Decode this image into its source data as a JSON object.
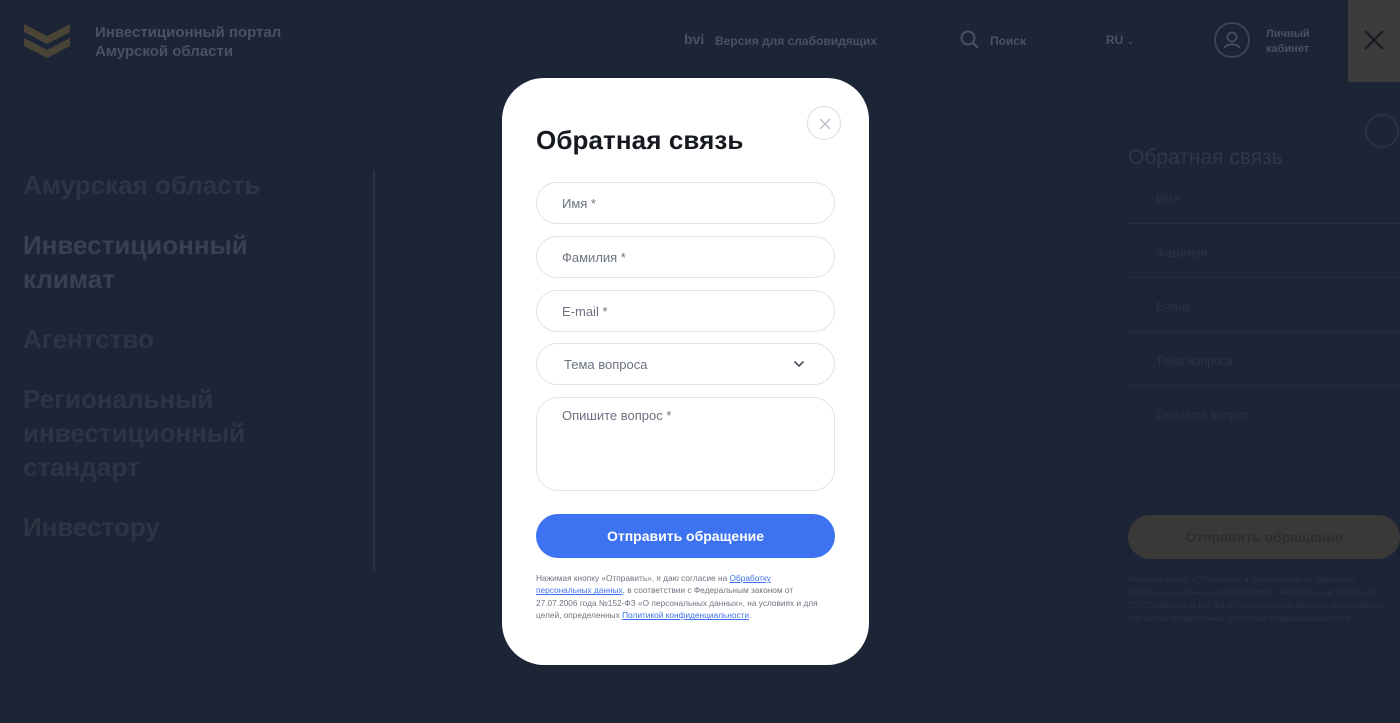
{
  "header": {
    "logo_line1": "Инвестиционный портал",
    "logo_line2": "Амурской области",
    "bvi_icon": "bvi",
    "accessibility_label": "Версия для слабовидящих",
    "search_label": "Поиск",
    "language": "RU",
    "cabinet_line1": "Личный",
    "cabinet_line2": "кабинет"
  },
  "menu": {
    "items": [
      {
        "label": "Амурская область"
      },
      {
        "label": "Инвестиционный климат"
      },
      {
        "label": "Агентство"
      },
      {
        "label": "Региональный инвестиционный стандарт"
      },
      {
        "label": "Инвестору"
      }
    ]
  },
  "background_form": {
    "title": "Обратная связь",
    "fields": [
      "Имя",
      "Фамилия",
      "E-mail",
      "Тема вопроса",
      "Опишите вопрос"
    ],
    "submit_label": "Отправить обращение"
  },
  "modal": {
    "title": "Обратная связь",
    "name_placeholder": "Имя *",
    "surname_placeholder": "Фамилия *",
    "email_placeholder": "E-mail *",
    "topic_label": "Тема вопроса",
    "question_placeholder": "Опишите вопрос *",
    "submit_label": "Отправить обращение",
    "consent": {
      "part1": "Нажимая кнопку «Отправить», я даю согласие на ",
      "link1": "Обработку персональных данных",
      "part2": ", в соответствии с Федеральным законом от 27.07.2006 года №152-ФЗ «О персональных данных», на условиях и для целей, определенных ",
      "link2": "Политикой конфиденциальности",
      "part3": "."
    }
  },
  "colors": {
    "background": "#1c2536",
    "accent": "#3d72f0",
    "modal_bg": "#ffffff"
  }
}
